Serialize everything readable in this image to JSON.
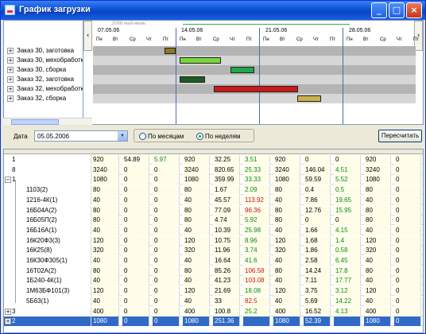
{
  "window": {
    "title": "График загрузки",
    "buttons": {
      "min": "_",
      "max": "□",
      "close": "×"
    }
  },
  "tree": {
    "items": [
      {
        "label": "Заказ 30, заготовка"
      },
      {
        "label": "Заказ 30, мехобработка"
      },
      {
        "label": "Заказ 30, сборка"
      },
      {
        "label": "Заказ 32, заготовка"
      },
      {
        "label": "Заказ 32, мехобработка"
      },
      {
        "label": "Заказ 32, сборка"
      }
    ]
  },
  "gantt": {
    "month_label": "2006 май-июнь",
    "dates": [
      "07.05.06",
      "14.05.06",
      "21.05.06",
      "28.05.06"
    ],
    "days": [
      "Пн",
      "Вт",
      "Ср",
      "Чт",
      "Пт",
      "Пн",
      "Вт",
      "Ср",
      "Чт",
      "Пт",
      "Пн",
      "Вт",
      "Ср",
      "Чт",
      "Пт",
      "Пн",
      "Вт",
      "Ср",
      "Чт",
      "Пт"
    ],
    "bar_colors": [
      "#8a7a20",
      "#7bd63a",
      "#1fa84a",
      "#1f5a1f",
      "#cc1a1a",
      "#c9b24a"
    ]
  },
  "toolbar": {
    "date_label": "Дата",
    "date_value": "05.05.2006",
    "radio_months": "По месяцам",
    "radio_weeks": "По неделям",
    "recalc": "Пересчитать"
  },
  "grid": {
    "rows": [
      {
        "name": "1",
        "c": [
          "920",
          "54.89",
          "5.97",
          "920",
          "32.25",
          "3.51",
          "920",
          "0",
          "0",
          "920",
          "0"
        ],
        "cls": [
          "",
          "",
          "g",
          "",
          "",
          "g",
          "",
          "",
          "",
          "",
          ""
        ]
      },
      {
        "name": "8",
        "c": [
          "3240",
          "0",
          "0",
          "3240",
          "820.65",
          "25.33",
          "3240",
          "146.04",
          "4.51",
          "3240",
          "0"
        ],
        "cls": [
          "",
          "",
          "",
          "",
          "",
          "g",
          "",
          "",
          "g",
          "",
          ""
        ]
      },
      {
        "name": "1",
        "c": [
          "1080",
          "0",
          "0",
          "1080",
          "359.99",
          "33.33",
          "1080",
          "59.59",
          "5.52",
          "1080",
          "0"
        ],
        "cls": [
          "",
          "",
          "",
          "",
          "",
          "g",
          "",
          "",
          "g",
          "",
          ""
        ]
      },
      {
        "name": "1103(2)",
        "c": [
          "80",
          "0",
          "0",
          "80",
          "1.67",
          "2.09",
          "80",
          "0.4",
          "0.5",
          "80",
          "0"
        ],
        "cls": [
          "",
          "",
          "",
          "",
          "",
          "g",
          "",
          "",
          "g",
          "",
          ""
        ]
      },
      {
        "name": "1216-4К(1)",
        "c": [
          "40",
          "0",
          "0",
          "40",
          "45.57",
          "113.92",
          "40",
          "7.86",
          "19.65",
          "40",
          "0"
        ],
        "cls": [
          "",
          "",
          "",
          "",
          "",
          "r",
          "",
          "",
          "g",
          "",
          ""
        ]
      },
      {
        "name": "16Б04А(2)",
        "c": [
          "80",
          "0",
          "0",
          "80",
          "77.09",
          "96.36",
          "80",
          "12.76",
          "15.95",
          "80",
          "0"
        ],
        "cls": [
          "",
          "",
          "",
          "",
          "",
          "r",
          "",
          "",
          "g",
          "",
          ""
        ]
      },
      {
        "name": "16Б05П(2)",
        "c": [
          "80",
          "0",
          "0",
          "80",
          "4.74",
          "5.92",
          "80",
          "0",
          "0",
          "80",
          "0"
        ],
        "cls": [
          "",
          "",
          "",
          "",
          "",
          "g",
          "",
          "",
          "",
          "",
          ""
        ]
      },
      {
        "name": "16Б16А(1)",
        "c": [
          "40",
          "0",
          "0",
          "40",
          "10.39",
          "25.98",
          "40",
          "1.66",
          "4.15",
          "40",
          "0"
        ],
        "cls": [
          "",
          "",
          "",
          "",
          "",
          "g",
          "",
          "",
          "g",
          "",
          ""
        ]
      },
      {
        "name": "16К20Ф3(3)",
        "c": [
          "120",
          "0",
          "0",
          "120",
          "10.75",
          "8.96",
          "120",
          "1.68",
          "1.4",
          "120",
          "0"
        ],
        "cls": [
          "",
          "",
          "",
          "",
          "",
          "g",
          "",
          "",
          "g",
          "",
          ""
        ]
      },
      {
        "name": "16К25(8)",
        "c": [
          "320",
          "0",
          "0",
          "320",
          "11.96",
          "3.74",
          "320",
          "1.86",
          "0.58",
          "320",
          "0"
        ],
        "cls": [
          "",
          "",
          "",
          "",
          "",
          "g",
          "",
          "",
          "g",
          "",
          ""
        ]
      },
      {
        "name": "16К30Ф305(1)",
        "c": [
          "40",
          "0",
          "0",
          "40",
          "16.64",
          "41.6",
          "40",
          "2.58",
          "6.45",
          "40",
          "0"
        ],
        "cls": [
          "",
          "",
          "",
          "",
          "",
          "g",
          "",
          "",
          "g",
          "",
          ""
        ]
      },
      {
        "name": "16Т02А(2)",
        "c": [
          "80",
          "0",
          "0",
          "80",
          "85.26",
          "106.58",
          "80",
          "14.24",
          "17.8",
          "80",
          "0"
        ],
        "cls": [
          "",
          "",
          "",
          "",
          "",
          "r",
          "",
          "",
          "g",
          "",
          ""
        ]
      },
      {
        "name": "1Б240-4К(1)",
        "c": [
          "40",
          "0",
          "0",
          "40",
          "41.23",
          "103.08",
          "40",
          "7.11",
          "17.77",
          "40",
          "0"
        ],
        "cls": [
          "",
          "",
          "",
          "",
          "",
          "r",
          "",
          "",
          "g",
          "",
          ""
        ]
      },
      {
        "name": "1М63БФ101(3)",
        "c": [
          "120",
          "0",
          "0",
          "120",
          "21.69",
          "18.08",
          "120",
          "3.75",
          "3.12",
          "120",
          "0"
        ],
        "cls": [
          "",
          "",
          "",
          "",
          "",
          "g",
          "",
          "",
          "g",
          "",
          ""
        ]
      },
      {
        "name": "5Б63(1)",
        "c": [
          "40",
          "0",
          "0",
          "40",
          "33",
          "82.5",
          "40",
          "5.69",
          "14.22",
          "40",
          "0"
        ],
        "cls": [
          "",
          "",
          "",
          "",
          "",
          "r",
          "",
          "",
          "g",
          "",
          ""
        ]
      },
      {
        "name": "3",
        "c": [
          "400",
          "0",
          "0",
          "400",
          "100.8",
          "25.2",
          "400",
          "16.52",
          "4.13",
          "400",
          "0"
        ],
        "cls": [
          "",
          "",
          "",
          "",
          "",
          "g",
          "",
          "",
          "g",
          "",
          ""
        ]
      },
      {
        "name": "2",
        "c": [
          "1080",
          "0",
          "0",
          "1080",
          "251.36",
          "",
          "1080",
          "52.39",
          "",
          "1080",
          "0"
        ],
        "cls": [
          "",
          "",
          "",
          "",
          "",
          "",
          "",
          "",
          "",
          "",
          ""
        ]
      }
    ]
  }
}
